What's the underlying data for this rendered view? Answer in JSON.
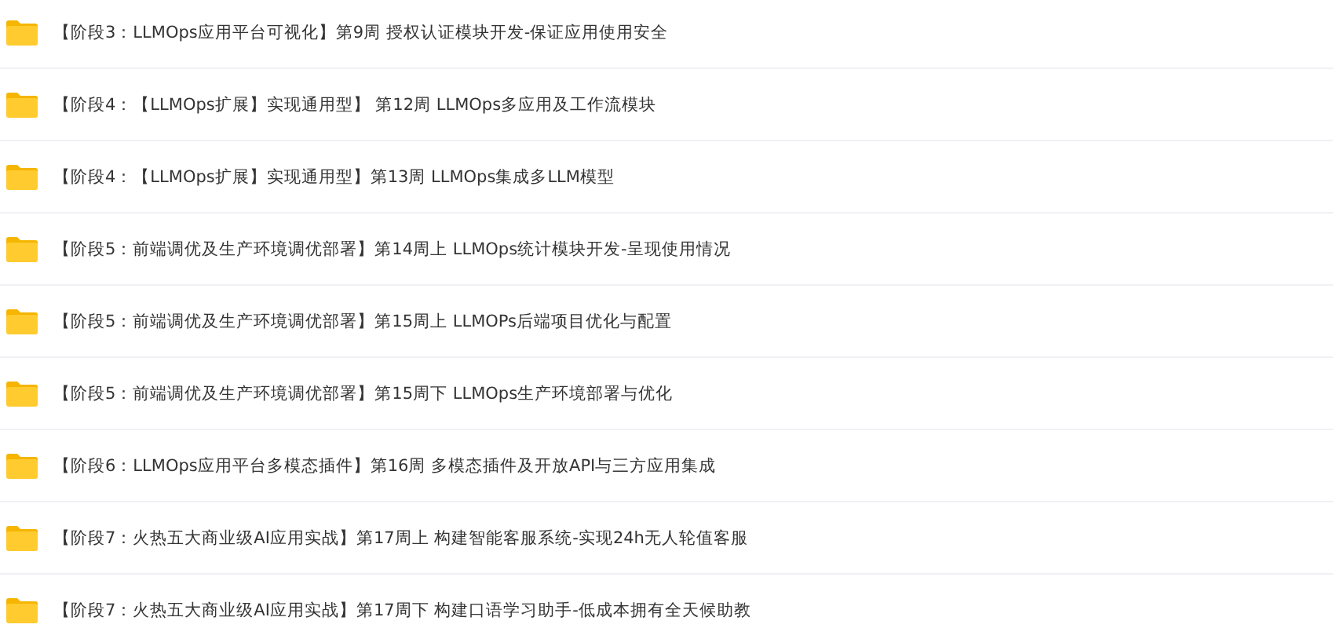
{
  "folders": [
    {
      "name": "【阶段3：LLMOps应用平台可视化】第9周 授权认证模块开发-保证应用使用安全"
    },
    {
      "name": "【阶段4：【LLMOps扩展】实现通用型】 第12周 LLMOps多应用及工作流模块"
    },
    {
      "name": "【阶段4：【LLMOps扩展】实现通用型】第13周 LLMOps集成多LLM模型"
    },
    {
      "name": "【阶段5：前端调优及生产环境调优部署】第14周上 LLMOps统计模块开发-呈现使用情况"
    },
    {
      "name": "【阶段5：前端调优及生产环境调优部署】第15周上 LLMOPs后端项目优化与配置"
    },
    {
      "name": "【阶段5：前端调优及生产环境调优部署】第15周下 LLMOps生产环境部署与优化"
    },
    {
      "name": "【阶段6：LLMOps应用平台多模态插件】第16周 多模态插件及开放API与三方应用集成"
    },
    {
      "name": "【阶段7：火热五大商业级AI应用实战】第17周上 构建智能客服系统-实现24h无人轮值客服"
    },
    {
      "name": "【阶段7：火热五大商业级AI应用实战】第17周下 构建口语学习助手-低成本拥有全天候助教"
    }
  ]
}
